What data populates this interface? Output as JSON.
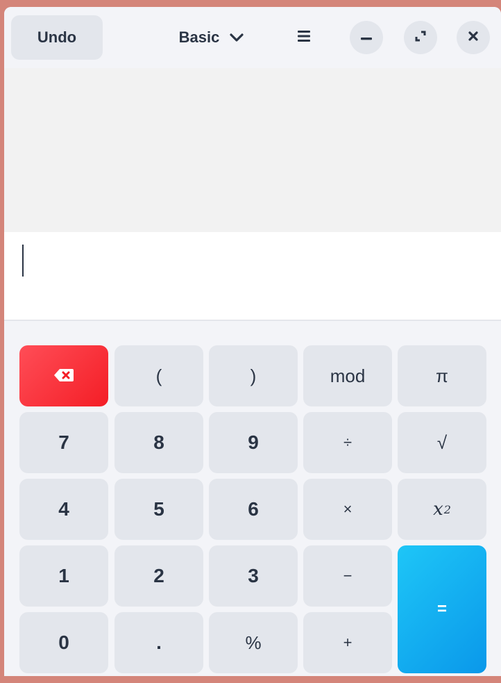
{
  "headerbar": {
    "undo_label": "Undo",
    "mode_label": "Basic",
    "mode_icon": "chevron-down-icon",
    "menu_icon": "hamburger-menu-icon",
    "minimize_icon": "minimize-icon",
    "maximize_icon": "maximize-icon",
    "close_icon": "close-icon"
  },
  "entry": {
    "value": ""
  },
  "keypad": {
    "backspace_icon": "backspace-icon",
    "open_paren": "(",
    "close_paren": ")",
    "mod": "mod",
    "pi": "π",
    "d7": "7",
    "d8": "8",
    "d9": "9",
    "divide": "÷",
    "sqrt": "√",
    "d4": "4",
    "d5": "5",
    "d6": "6",
    "multiply": "×",
    "square_base": "x",
    "square_exp": "2",
    "d1": "1",
    "d2": "2",
    "d3": "3",
    "subtract": "−",
    "equals": "=",
    "d0": "0",
    "decimal": ".",
    "percent": "%",
    "add": "+"
  },
  "colors": {
    "backspace": "#f41e26",
    "equals_start": "#1ec6f7",
    "equals_end": "#0a98ea",
    "key_bg": "#e3e6ec",
    "text": "#2a3444"
  }
}
